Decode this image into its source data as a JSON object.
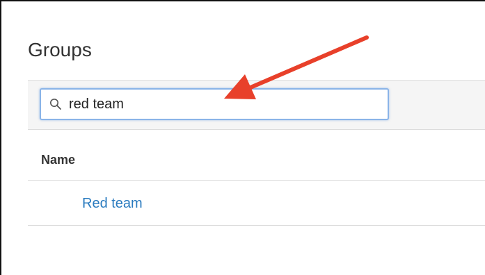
{
  "page": {
    "title": "Groups"
  },
  "search": {
    "value": "red team",
    "icon": "search-icon"
  },
  "table": {
    "columns": [
      "Name"
    ],
    "rows": [
      {
        "name": "Red team"
      }
    ]
  },
  "annotation": {
    "arrow_color": "#e8402a"
  },
  "colors": {
    "link": "#2a7bbf",
    "focus_border": "#8ab4e8"
  }
}
